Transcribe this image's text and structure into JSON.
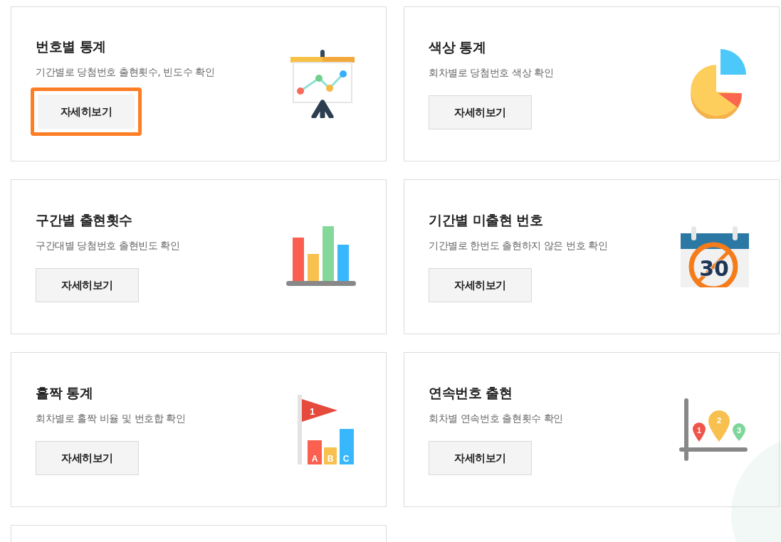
{
  "cards": [
    {
      "title": "번호별 통계",
      "description": "기간별로 당첨번호 출현횟수, 빈도수 확인",
      "button": "자세히보기",
      "focused": true,
      "kind": "presentation"
    },
    {
      "title": "색상 통계",
      "description": "회차별로 당첨번호 색상 확인",
      "button": "자세히보기",
      "focused": false,
      "kind": "pie"
    },
    {
      "title": "구간별 출현횟수",
      "description": "구간대별 당첨번호 출현빈도 확인",
      "button": "자세히보기",
      "focused": false,
      "kind": "bars"
    },
    {
      "title": "기간별 미출현 번호",
      "description": "기간별로 한번도 출현하지 않은 번호 확인",
      "button": "자세히보기",
      "focused": false,
      "kind": "calendar",
      "icon_labels": [
        "30"
      ]
    },
    {
      "title": "홀짝 통계",
      "description": "회차별로 홀짝 비율 및 번호합 확인",
      "button": "자세히보기",
      "focused": false,
      "kind": "flag",
      "icon_labels": [
        "1",
        "A",
        "B",
        "C"
      ]
    },
    {
      "title": "연속번호 출현",
      "description": "회차별 연속번호 출현횟수 확인",
      "button": "자세히보기",
      "focused": false,
      "kind": "pins",
      "icon_labels": [
        "1",
        "2",
        "3"
      ]
    }
  ],
  "cut_off_card": true
}
